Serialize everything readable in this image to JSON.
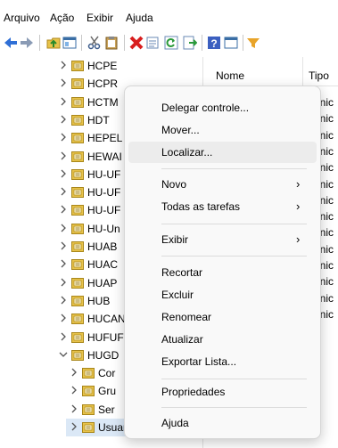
{
  "menubar": {
    "items": [
      "Arquivo",
      "Ação",
      "Exibir",
      "Ajuda"
    ]
  },
  "tree": {
    "items": [
      {
        "label": "HCPE"
      },
      {
        "label": "HCPR"
      },
      {
        "label": "HCTM"
      },
      {
        "label": "HDT"
      },
      {
        "label": "HEPEL"
      },
      {
        "label": "HEWAI"
      },
      {
        "label": "HU-UF"
      },
      {
        "label": "HU-UF"
      },
      {
        "label": "HU-UF"
      },
      {
        "label": "HU-Un"
      },
      {
        "label": "HUAB"
      },
      {
        "label": "HUAC"
      },
      {
        "label": "HUAP"
      },
      {
        "label": "HUB"
      },
      {
        "label": "HUCAN"
      },
      {
        "label": "HUFUF"
      },
      {
        "label": "HUGD"
      },
      {
        "label": "Cor"
      },
      {
        "label": "Gru"
      },
      {
        "label": "Ser"
      },
      {
        "label": "Usuarios"
      }
    ]
  },
  "list": {
    "columns": [
      "Nome",
      "Tipo"
    ],
    "type_cells": [
      "Unic",
      "Unic",
      "Unic",
      "Unic",
      "Unic",
      "Unic",
      "Unic",
      "Unic",
      "Unic",
      "Unic",
      "Unic",
      "Unic",
      "Unic",
      "Unic"
    ]
  },
  "context_menu": {
    "items": {
      "delegar": "Delegar controle...",
      "mover": "Mover...",
      "localizar": "Localizar...",
      "novo": "Novo",
      "todas": "Todas as tarefas",
      "exibir": "Exibir",
      "recortar": "Recortar",
      "excluir": "Excluir",
      "renomear": "Renomear",
      "atualizar": "Atualizar",
      "exportar": "Exportar Lista...",
      "propriedades": "Propriedades",
      "ajuda": "Ajuda"
    },
    "submenu_arrow": "›"
  },
  "icons": {
    "back": "arrow-left-icon",
    "forward": "arrow-right-icon",
    "up": "folder-up-icon",
    "console": "console-tree-icon",
    "cut": "cut-icon",
    "copy": "clipboard-icon",
    "delete": "delete-icon",
    "properties": "properties-icon",
    "refresh": "refresh-icon",
    "export": "export-list-icon",
    "help": "help-icon",
    "view": "view-icon",
    "filter": "filter-icon"
  },
  "colors": {
    "accent": "#2f6fd6",
    "folder": "#e8c34a",
    "delete_red": "#d81e1e",
    "selection": "#dbe8f6"
  }
}
